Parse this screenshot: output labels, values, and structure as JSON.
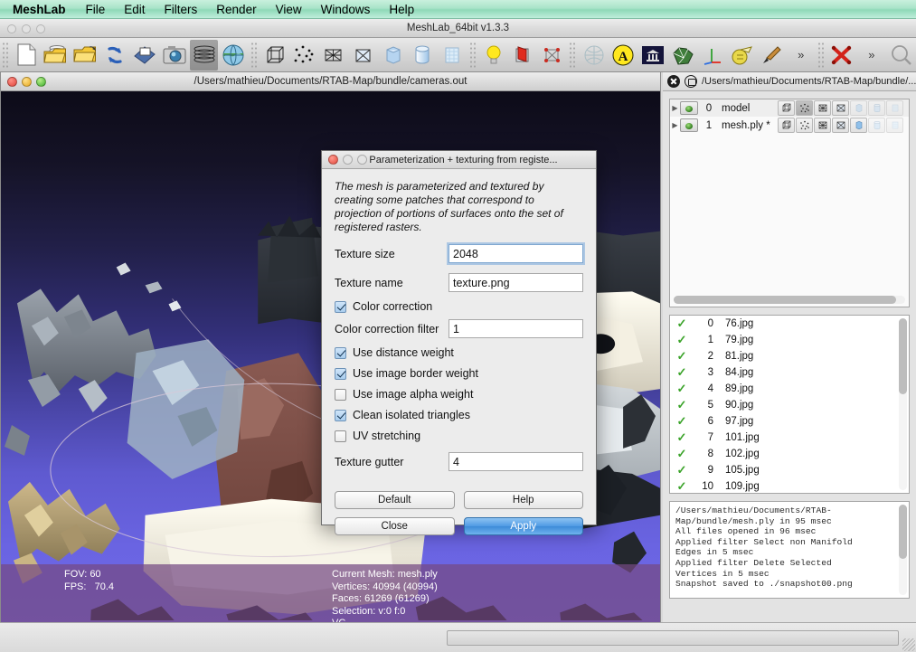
{
  "menubar": {
    "app_name": "MeshLab",
    "items": [
      {
        "label": "File"
      },
      {
        "label": "Edit"
      },
      {
        "label": "Filters"
      },
      {
        "label": "Render"
      },
      {
        "label": "View"
      },
      {
        "label": "Windows"
      },
      {
        "label": "Help"
      }
    ]
  },
  "app_window": {
    "title": "MeshLab_64bit v1.3.3"
  },
  "toolbar": {
    "buttons": [
      {
        "name": "new-document-icon",
        "active": false
      },
      {
        "name": "open-project-icon",
        "active": false
      },
      {
        "name": "open-mesh-icon",
        "active": false
      },
      {
        "name": "reload-icon",
        "active": false
      },
      {
        "name": "save-mesh-icon",
        "active": false
      },
      {
        "name": "snapshot-camera-icon",
        "active": false
      },
      {
        "name": "layers-icon",
        "active": true
      },
      {
        "name": "raster-globe-icon",
        "active": false
      },
      {
        "name": "bounding-box-icon",
        "active": false
      },
      {
        "name": "points-icon",
        "active": false
      },
      {
        "name": "wireframe-icon",
        "active": false
      },
      {
        "name": "hidden-lines-icon",
        "active": false
      },
      {
        "name": "flat-shading-icon",
        "active": false
      },
      {
        "name": "smooth-shading-icon",
        "active": false
      },
      {
        "name": "texture-shading-icon",
        "active": false
      },
      {
        "name": "light-bulb-icon",
        "active": false
      },
      {
        "name": "double-side-lighting-icon",
        "active": false
      },
      {
        "name": "vertex-quality-icon",
        "active": false
      },
      {
        "name": "sphere-mapping-icon",
        "active": false
      },
      {
        "name": "anisotropy-icon",
        "active": false
      },
      {
        "name": "museum-background-icon",
        "active": false
      },
      {
        "name": "mesh-render-icon",
        "active": false
      },
      {
        "name": "axis-trackball-icon",
        "active": false
      },
      {
        "name": "measure-tool-icon",
        "active": false
      },
      {
        "name": "paint-brush-icon",
        "active": false
      },
      {
        "name": "overflow-chevron-1",
        "active": false
      },
      {
        "name": "delete-selection-icon",
        "active": false
      },
      {
        "name": "overflow-chevron-2",
        "active": false
      },
      {
        "name": "zoom-magnifier-icon",
        "active": false
      }
    ]
  },
  "document_window": {
    "title": "/Users/mathieu/Documents/RTAB-Map/bundle/cameras.out",
    "status": {
      "left": [
        "FOV: 60",
        "FPS:   70.4"
      ],
      "right": [
        "Current Mesh: mesh.ply",
        "Vertices: 40994 (40994)",
        "Faces: 61269 (61269)",
        "Selection: v:0 f:0",
        "VC"
      ]
    }
  },
  "right_panel": {
    "title": "/Users/mathieu/Documents/RTAB-Map/bundle/...",
    "layers": [
      {
        "index": "0",
        "name": "model",
        "expandable": true,
        "visible": true,
        "render_flags": [
          false,
          true,
          false,
          false,
          false,
          false,
          false
        ]
      },
      {
        "index": "1",
        "name": "mesh.ply *",
        "expandable": true,
        "visible": true,
        "render_flags": [
          false,
          false,
          false,
          false,
          true,
          false,
          false
        ]
      }
    ],
    "layer_button_icons": [
      "bbox-icon",
      "points-icon",
      "wireframe-icon",
      "hidden-lines-icon",
      "flat-icon",
      "smooth-icon",
      "texture-icon"
    ],
    "rasters": [
      {
        "checked": true,
        "index": "0",
        "name": "76.jpg"
      },
      {
        "checked": true,
        "index": "1",
        "name": "79.jpg"
      },
      {
        "checked": true,
        "index": "2",
        "name": "81.jpg"
      },
      {
        "checked": true,
        "index": "3",
        "name": "84.jpg"
      },
      {
        "checked": true,
        "index": "4",
        "name": "89.jpg"
      },
      {
        "checked": true,
        "index": "5",
        "name": "90.jpg"
      },
      {
        "checked": true,
        "index": "6",
        "name": "97.jpg"
      },
      {
        "checked": true,
        "index": "7",
        "name": "101.jpg"
      },
      {
        "checked": true,
        "index": "8",
        "name": "102.jpg"
      },
      {
        "checked": true,
        "index": "9",
        "name": "105.jpg"
      },
      {
        "checked": true,
        "index": "10",
        "name": "109.jpg"
      }
    ],
    "log_text": "/Users/mathieu/Documents/RTAB-\nMap/bundle/mesh.ply in 95 msec\nAll files opened in 96 msec\nApplied filter Select non Manifold\nEdges in 5 msec\nApplied filter Delete Selected\nVertices in 5 msec\nSnapshot saved to ./snapshot00.png"
  },
  "dialog": {
    "title": "Parameterization + texturing from registe...",
    "description": "The mesh is parameterized and textured by creating some patches that correspond to projection of portions of surfaces onto the set of registered rasters.",
    "fields": [
      {
        "label": "Texture size",
        "value": "2048",
        "focused": true
      },
      {
        "label": "Texture name",
        "value": "texture.png",
        "focused": false
      }
    ],
    "color_correction": {
      "label": "Color correction",
      "checked": true
    },
    "color_correction_filter": {
      "label": "Color correction filter",
      "value": "1"
    },
    "checkboxes": [
      {
        "label": "Use distance weight",
        "checked": true
      },
      {
        "label": "Use image border weight",
        "checked": true
      },
      {
        "label": "Use image alpha weight",
        "checked": false
      },
      {
        "label": "Clean isolated triangles",
        "checked": true
      },
      {
        "label": "UV stretching",
        "checked": false
      }
    ],
    "texture_gutter": {
      "label": "Texture gutter",
      "value": "4"
    },
    "buttons": {
      "default": "Default",
      "help": "Help",
      "close": "Close",
      "apply": "Apply"
    }
  },
  "colors": {
    "menubar_accent": "#8fd9b8",
    "apply_button": "#4e9ae4",
    "status_overlay": "#744a82",
    "check_green": "#3aa329",
    "viewport_sky_top": "#0d0b18",
    "viewport_sky_bottom": "#6f69e8"
  }
}
